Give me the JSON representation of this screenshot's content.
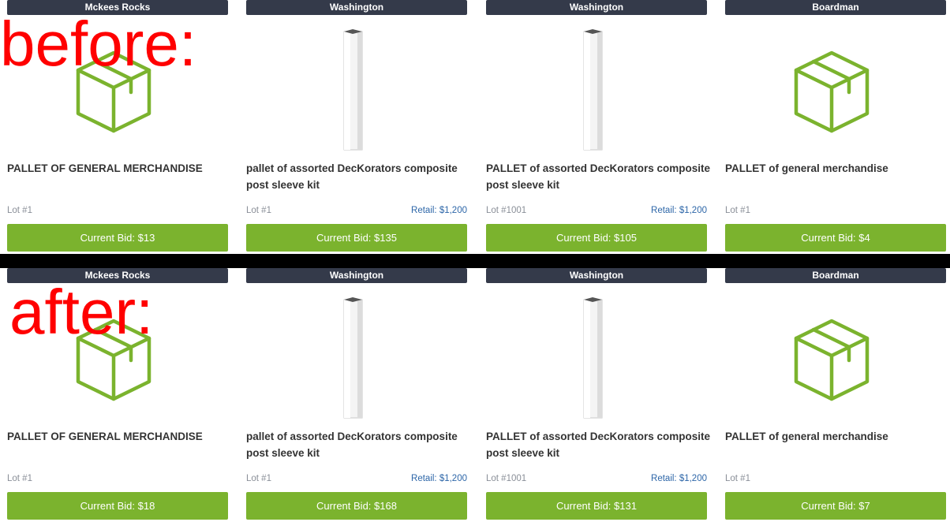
{
  "labels": {
    "before": "before:",
    "after": "after:"
  },
  "colors": {
    "location_bar": "#343a4a",
    "bid_button": "#7bb32e",
    "retail_text": "#2d66a8",
    "annotation": "#ff0000",
    "divider": "#000000"
  },
  "before": {
    "cards": [
      {
        "location": "Mckees Rocks",
        "image": "box-icon",
        "title": "PALLET OF GENERAL MERCHANDISE",
        "lot": "Lot #1",
        "retail": "",
        "bid": "Current Bid: $13"
      },
      {
        "location": "Washington",
        "image": "post-sleeve-image",
        "title": "pallet of assorted DecKorators composite post sleeve kit",
        "lot": "Lot #1",
        "retail": "Retail: $1,200",
        "bid": "Current Bid: $135"
      },
      {
        "location": "Washington",
        "image": "post-sleeve-image",
        "title": "PALLET of assorted DecKorators composite post sleeve kit",
        "lot": "Lot #1001",
        "retail": "Retail: $1,200",
        "bid": "Current Bid: $105"
      },
      {
        "location": "Boardman",
        "image": "box-icon",
        "title": "PALLET of general merchandise",
        "lot": "Lot #1",
        "retail": "",
        "bid": "Current Bid: $4"
      }
    ]
  },
  "after": {
    "cards": [
      {
        "location": "Mckees Rocks",
        "image": "box-icon",
        "title": "PALLET OF GENERAL MERCHANDISE",
        "lot": "Lot #1",
        "retail": "",
        "bid": "Current Bid: $18"
      },
      {
        "location": "Washington",
        "image": "post-sleeve-image",
        "title": "pallet of assorted DecKorators composite post sleeve kit",
        "lot": "Lot #1",
        "retail": "Retail: $1,200",
        "bid": "Current Bid: $168"
      },
      {
        "location": "Washington",
        "image": "post-sleeve-image",
        "title": "PALLET of assorted DecKorators composite post sleeve kit",
        "lot": "Lot #1001",
        "retail": "Retail: $1,200",
        "bid": "Current Bid: $131"
      },
      {
        "location": "Boardman",
        "image": "box-icon",
        "title": "PALLET of general merchandise",
        "lot": "Lot #1",
        "retail": "",
        "bid": "Current Bid: $7"
      }
    ]
  }
}
